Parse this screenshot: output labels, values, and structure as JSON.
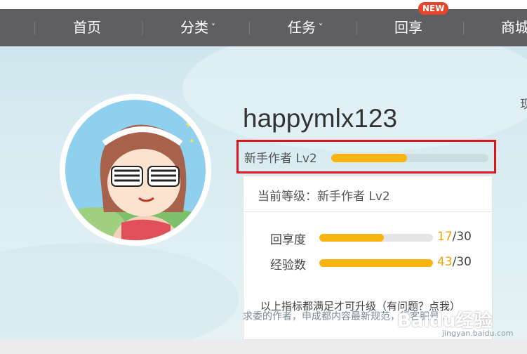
{
  "nav": {
    "items": [
      {
        "label": "首页",
        "has_dropdown": false
      },
      {
        "label": "分类",
        "has_dropdown": true
      },
      {
        "label": "任务",
        "has_dropdown": true
      },
      {
        "label": "回享",
        "has_dropdown": false
      },
      {
        "label": "商城",
        "has_dropdown": false
      }
    ],
    "new_badge": "NEW",
    "chevron": "˅"
  },
  "profile": {
    "username": "happymlx123",
    "level_label": "新手作者 Lv2",
    "level_progress": 0.48
  },
  "panel": {
    "current_level": "当前等级：新手作者 Lv2",
    "stats": [
      {
        "label": "回享度",
        "current": "17",
        "total": "/30",
        "fraction": 0.567
      },
      {
        "label": "经验数",
        "current": "43",
        "total": "/30",
        "fraction": 1.0
      }
    ],
    "note": "以上指标都满足才可升级（有问题？点我）"
  },
  "background_text": {
    "partial_line": "求委的作者，申成都内容最新规范，行客服号...",
    "right_edge_char": "现"
  },
  "watermark": {
    "text": "Baidu经验",
    "sub": "jingyan.baidu.com"
  },
  "colors": {
    "nav_bg": "#5f5f63",
    "accent_bar": "#f9b411",
    "highlight_border": "#d9161b",
    "badge": "#e8452c"
  }
}
